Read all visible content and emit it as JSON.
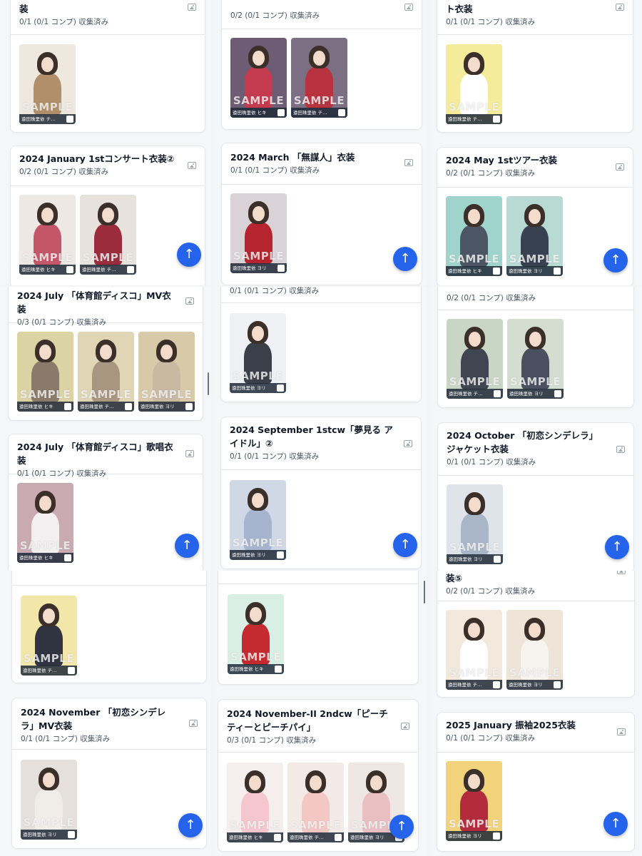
{
  "member_name": "遠田珠里依",
  "sample_text": "SAMPLE",
  "scroll_top_icon": "arrow-up-icon",
  "panels": [
    {
      "cards": [
        {
          "title": "装",
          "subtitle": "0/1 (0/1 コンプ) 収集済み",
          "photos": [
            {
              "caption": "遠田珠里依 チ…",
              "bg": "#efe8df",
              "outfit": "#b08f6a"
            }
          ]
        },
        {
          "title": "2024 January 1stコンサート衣装②",
          "subtitle": "0/2 (0/1 コンプ) 収集済み",
          "photos": [
            {
              "caption": "遠田珠里依 ヒキ",
              "bg": "#ede8e3",
              "outfit": "#c4566a"
            },
            {
              "caption": "遠田珠里依 チ…",
              "bg": "#e8e2dc",
              "outfit": "#9b2c3c"
            }
          ]
        }
      ]
    },
    {
      "cards": [
        {
          "title": "",
          "subtitle": "0/2 (0/1 コンプ) 収集済み",
          "photos": [
            {
              "caption": "遠田珠里依 ヒキ",
              "bg": "#6d5c73",
              "outfit": "#c43a4e"
            },
            {
              "caption": "遠田珠里依 チ…",
              "bg": "#7c6f84",
              "outfit": "#b8323f"
            }
          ]
        },
        {
          "title": "2024 March 「無謀人」衣装",
          "subtitle": "0/1 (0/1 コンプ) 収集済み",
          "photos": [
            {
              "caption": "遠田珠里依 ヨリ",
              "bg": "#d9d2d6",
              "outfit": "#b5252f"
            }
          ]
        }
      ]
    },
    {
      "cards": [
        {
          "title": "ト衣装",
          "subtitle": "0/1 (0/1 コンプ) 収集済み",
          "photos": [
            {
              "caption": "遠田珠里依 チ…",
              "bg": "#f4ec9a",
              "outfit": "#ffffff"
            }
          ]
        },
        {
          "title": "2024 May 1stツアー衣装",
          "subtitle": "0/2 (0/1 コンプ) 収集済み",
          "photos": [
            {
              "caption": "遠田珠里依 ヒキ",
              "bg": "#9ed4cc",
              "outfit": "#4b5563"
            },
            {
              "caption": "遠田珠里依 ヨリ",
              "bg": "#b7dad2",
              "outfit": "#374151"
            }
          ]
        }
      ]
    },
    {
      "cards": [
        {
          "title": "2024 July 「体育館ディスコ」MV衣装",
          "subtitle": "0/3 (0/1 コンプ) 収集済み",
          "photos": [
            {
              "caption": "遠田珠里依 ヒキ",
              "bg": "#dcd3a5",
              "outfit": "#8a7a6a"
            },
            {
              "caption": "遠田珠里依 チ…",
              "bg": "#e0d6b5",
              "outfit": "#a99680"
            },
            {
              "caption": "遠田珠里依 ヨリ",
              "bg": "#d8c9a8",
              "outfit": "#c9b8a2"
            }
          ]
        },
        {
          "title": "2024 July 「体育館ディスコ」歌唱衣装",
          "subtitle": "0/1 (0/1 コンプ) 収集済み",
          "photos": [
            {
              "caption": "遠田珠里依 ヒキ",
              "bg": "#c9a9b2",
              "outfit": "#f3eef0"
            }
          ]
        }
      ]
    },
    {
      "cards": [
        {
          "title": "",
          "subtitle": "0/1 (0/1 コンプ) 収集済み",
          "photos": [
            {
              "caption": "遠田珠里依 ヨリ",
              "bg": "#eef0f3",
              "outfit": "#3a3f4a"
            }
          ]
        },
        {
          "title": "2024 September 1stcw「夢見る アイドル」②",
          "subtitle": "0/1 (0/1 コンプ) 収集済み",
          "photos": [
            {
              "caption": "遠田珠里依 ヨリ",
              "bg": "#cfd8e4",
              "outfit": "#a6b4cf"
            }
          ]
        }
      ]
    },
    {
      "cards": [
        {
          "title": "",
          "subtitle": "0/2 (0/1 コンプ) 収集済み",
          "photos": [
            {
              "caption": "遠田珠里依 チ…",
              "bg": "#c9d6c6",
              "outfit": "#3f4652"
            },
            {
              "caption": "遠田珠里依 ヨリ",
              "bg": "#d4ded0",
              "outfit": "#4a5060"
            }
          ]
        },
        {
          "title": "2024 October 「初恋シンデレラ」ジャケット衣装",
          "subtitle": "0/1 (0/1 コンプ) 収集済み",
          "photos": [
            {
              "caption": "遠田珠里依 ヨリ",
              "bg": "#dfe3ea",
              "outfit": "#a9b6c8"
            }
          ]
        }
      ]
    },
    {
      "cards": [
        {
          "title": "",
          "subtitle": "",
          "photos": [
            {
              "caption": "遠田珠里依 チ…",
              "bg": "#f2e6a8",
              "outfit": "#2f3440"
            }
          ]
        },
        {
          "title": "2024 November 「初恋シンデレラ」MV衣装",
          "subtitle": "0/1 (0/1 コンプ) 収集済み",
          "photos": [
            {
              "caption": "遠田珠里依 ヨリ",
              "bg": "#e6e0dc",
              "outfit": "#f0ece8"
            }
          ]
        }
      ]
    },
    {
      "cards": [
        {
          "title": "",
          "subtitle": "",
          "photos": [
            {
              "caption": "遠田珠里依 ヒキ",
              "bg": "#d9efe6",
              "outfit": "#c42a2f"
            }
          ]
        },
        {
          "title": "2024 November-II 2ndcw「ピーチティーとピーチパイ」",
          "subtitle": "0/3 (0/1 コンプ) 収集済み",
          "photos": [
            {
              "caption": "遠田珠里依 ヒキ",
              "bg": "#f4eeee",
              "outfit": "#f6c6cf"
            },
            {
              "caption": "遠田珠里依 チ…",
              "bg": "#f3e9e6",
              "outfit": "#f3c7c3"
            },
            {
              "caption": "遠田珠里依 ヨリ",
              "bg": "#efe7e4",
              "outfit": "#e9bfc2"
            }
          ]
        }
      ]
    },
    {
      "cards": [
        {
          "title": "装⑤",
          "subtitle": "0/2 (0/1 コンプ) 収集済み",
          "photos": [
            {
              "caption": "遠田珠里依 チ…",
              "bg": "#f3e8dc",
              "outfit": "#ffffff"
            },
            {
              "caption": "遠田珠里依 ヨリ",
              "bg": "#efe4d8",
              "outfit": "#f7f4f0"
            }
          ]
        },
        {
          "title": "2025 January 振袖2025衣装",
          "subtitle": "0/1 (0/1 コンプ) 収集済み",
          "photos": [
            {
              "caption": "遠田珠里依 ヨリ",
              "bg": "#f2d27a",
              "outfit": "#b32b3c"
            }
          ]
        }
      ]
    }
  ]
}
